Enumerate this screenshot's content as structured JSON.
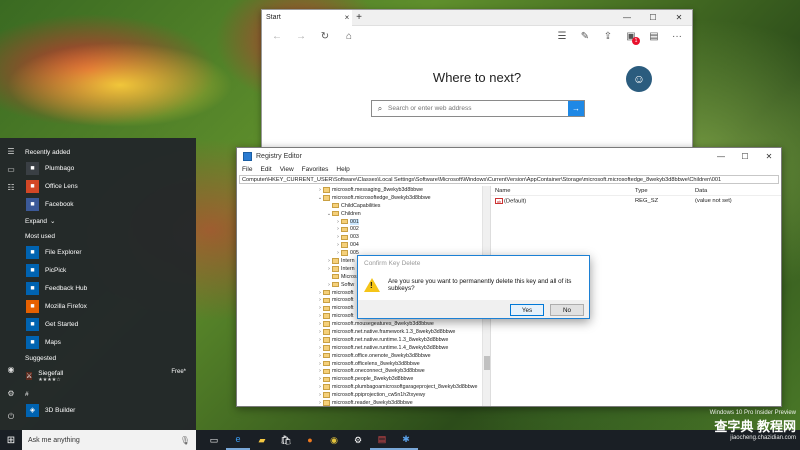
{
  "edge": {
    "tab_title": "Start",
    "tab_close": "×",
    "new_tab": "+",
    "win_controls": [
      "—",
      "☐",
      "✕"
    ],
    "nav_icons": [
      "back-arrow-icon",
      "forward-arrow-icon",
      "refresh-icon",
      "home-icon"
    ],
    "right_icons": [
      "hub-icon",
      "web-note-icon",
      "share-icon",
      "extension-icon",
      "reading-view-icon",
      "more-icon"
    ],
    "extension_badge": "1",
    "heading": "Where to next?",
    "search_placeholder": "Search or enter web address"
  },
  "regedit": {
    "title": "Registry Editor",
    "menu": [
      "File",
      "Edit",
      "View",
      "Favorites",
      "Help"
    ],
    "address": "Computer\\HKEY_CURRENT_USER\\Software\\Classes\\Local Settings\\Software\\Microsoft\\Windows\\CurrentVersion\\AppContainer\\Storage\\microsoft.microsoftedge_8wekyb3d8bbwe\\Children\\001",
    "tree": [
      {
        "label": "microsoft.messaging_8wekyb3d8bbwe",
        "indent": 0,
        "exp": "›"
      },
      {
        "label": "microsoft.microsoftedge_8wekyb3d8bbwe",
        "indent": 0,
        "exp": "⌄"
      },
      {
        "label": "ChildCapabilities",
        "indent": 1,
        "exp": ""
      },
      {
        "label": "Children",
        "indent": 1,
        "exp": "⌄"
      },
      {
        "label": "001",
        "indent": 2,
        "exp": "›",
        "selected": true
      },
      {
        "label": "002",
        "indent": 2,
        "exp": "›"
      },
      {
        "label": "003",
        "indent": 2,
        "exp": "›"
      },
      {
        "label": "004",
        "indent": 2,
        "exp": "›"
      },
      {
        "label": "005",
        "indent": 2,
        "exp": "›"
      },
      {
        "label": "Intern",
        "indent": 1,
        "exp": "›"
      },
      {
        "label": "Intern",
        "indent": 1,
        "exp": "›"
      },
      {
        "label": "Micros",
        "indent": 1,
        "exp": ""
      },
      {
        "label": "Softw",
        "indent": 1,
        "exp": "›"
      },
      {
        "label": "microsoft",
        "indent": 0,
        "exp": "›"
      },
      {
        "label": "microsoft",
        "indent": 0,
        "exp": "›"
      },
      {
        "label": "microsoft",
        "indent": 0,
        "exp": "›"
      },
      {
        "label": "microsoft",
        "indent": 0,
        "exp": "›"
      },
      {
        "label": "microsoft.mousegeatures_8wekyb3d8bbwe",
        "indent": 0,
        "exp": "›"
      },
      {
        "label": "microsoft.net.native.framework.1.3_8wekyb3d8bbwe",
        "indent": 0,
        "exp": "›"
      },
      {
        "label": "microsoft.net.native.runtime.1.3_8wekyb3d8bbwe",
        "indent": 0,
        "exp": "›"
      },
      {
        "label": "microsoft.net.native.runtime.1.4_8wekyb3d8bbwe",
        "indent": 0,
        "exp": "›"
      },
      {
        "label": "microsoft.office.onenote_8wekyb3d8bbwe",
        "indent": 0,
        "exp": "›"
      },
      {
        "label": "microsoft.officelens_8wekyb3d8bbwe",
        "indent": 0,
        "exp": "›"
      },
      {
        "label": "microsoft.oneconnect_8wekyb3d8bbwe",
        "indent": 0,
        "exp": "›"
      },
      {
        "label": "microsoft.people_8wekyb3d8bbwe",
        "indent": 0,
        "exp": "›"
      },
      {
        "label": "microsoft.plumbagoamicrosoftgarageproject_8wekyb3d8bbwe",
        "indent": 0,
        "exp": "›"
      },
      {
        "label": "microsoft.ppiprojection_cw5n1h2txyewy",
        "indent": 0,
        "exp": "›"
      },
      {
        "label": "microsoft.reader_8wekyb3d8bbwe",
        "indent": 0,
        "exp": "›"
      }
    ],
    "columns": [
      "Name",
      "Type",
      "Data"
    ],
    "values": [
      {
        "name": "(Default)",
        "type": "REG_SZ",
        "data": "(value not set)"
      }
    ]
  },
  "dialog": {
    "title": "Confirm Key Delete",
    "message": "Are you sure you want to permanently delete this key and all of its subkeys?",
    "yes": "Yes",
    "no": "No"
  },
  "start": {
    "recently_added": "Recently added",
    "recent": [
      {
        "label": "Plumbago",
        "icon": "plumbago-icon",
        "color": "#3a3f44"
      },
      {
        "label": "Office Lens",
        "icon": "office-lens-icon",
        "color": "#d24726"
      },
      {
        "label": "Facebook",
        "icon": "facebook-icon",
        "color": "#3b5998"
      }
    ],
    "expand": "Expand",
    "most_used": "Most used",
    "most": [
      {
        "label": "File Explorer",
        "icon": "folder-icon",
        "color": "#0063b1"
      },
      {
        "label": "PicPick",
        "icon": "picpick-icon",
        "color": "#0063b1"
      },
      {
        "label": "Feedback Hub",
        "icon": "feedback-icon",
        "color": "#0063b1"
      },
      {
        "label": "Mozilla Firefox",
        "icon": "firefox-icon",
        "color": "#e66000"
      },
      {
        "label": "Get Started",
        "icon": "get-started-icon",
        "color": "#0063b1"
      },
      {
        "label": "Maps",
        "icon": "maps-icon",
        "color": "#0063b1"
      }
    ],
    "suggested": "Suggested",
    "suggest_app": "Siegefall",
    "suggest_stars": "★★★★☆",
    "suggest_price": "Free*",
    "hash": "#",
    "bottom_app": "3D Builder"
  },
  "taskbar": {
    "search_text": "Ask me anything",
    "icons": [
      "task-view-icon",
      "edge-icon",
      "file-explorer-icon",
      "store-icon",
      "firefox-icon",
      "chrome-icon",
      "settings-icon",
      "photos-icon",
      "regedit-icon"
    ]
  },
  "watermark": {
    "line1": "Windows 10 Pro Insider Preview",
    "line2": "查字典 教程网",
    "line3": "jiaocheng.chazidian.com"
  }
}
